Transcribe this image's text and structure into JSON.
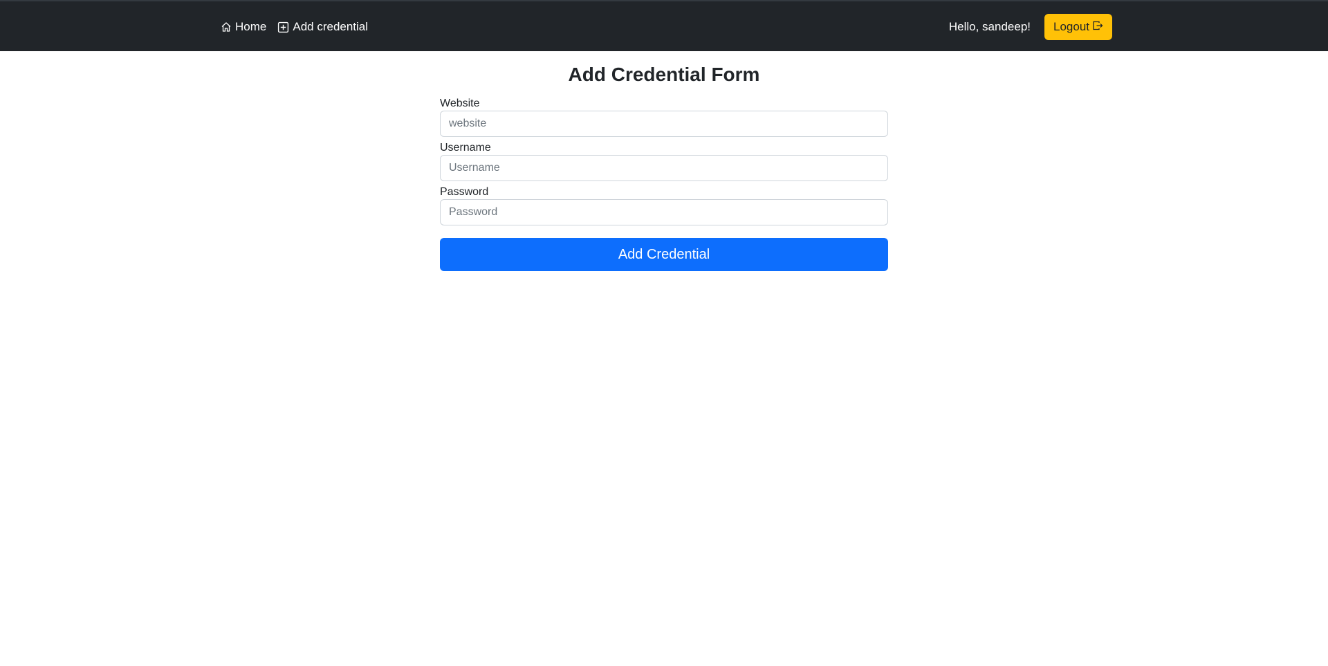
{
  "navbar": {
    "home_label": "Home",
    "add_label": "Add credential",
    "greeting": "Hello, sandeep!",
    "logout_label": "Logout",
    "icons": {
      "home": "house-icon",
      "add": "plus-square-icon",
      "logout": "box-arrow-right-icon"
    }
  },
  "form": {
    "title": "Add Credential Form",
    "website": {
      "label": "Website",
      "placeholder": "website",
      "value": ""
    },
    "username": {
      "label": "Username",
      "placeholder": "Username",
      "value": ""
    },
    "password": {
      "label": "Password",
      "placeholder": "Password",
      "value": ""
    },
    "submit_label": "Add Credential"
  },
  "colors": {
    "navbar_bg": "#212529",
    "logout_bg": "#ffc107",
    "primary": "#0d6efd"
  }
}
